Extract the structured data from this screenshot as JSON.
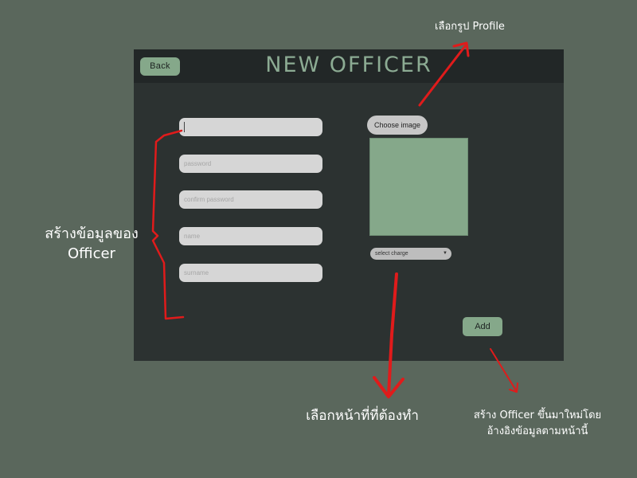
{
  "window": {
    "back_label": "Back",
    "title": "NEW OFFICER"
  },
  "form": {
    "fields": [
      {
        "placeholder": ""
      },
      {
        "placeholder": "password"
      },
      {
        "placeholder": "confirm password"
      },
      {
        "placeholder": "name"
      },
      {
        "placeholder": "surname"
      }
    ],
    "choose_image_label": "Choose image",
    "charge_select_value": "select charge",
    "add_label": "Add"
  },
  "annotations": {
    "profile_note": "เลือกรูป Profile",
    "officer_data_line1": "สร้างข้อมูลของ",
    "officer_data_line2": "Officer",
    "charge_note": "เลือกหน้าที่ที่ต้องทำ",
    "create_note_line1": "สร้าง Officer ขึ้นมาใหม่โดย",
    "create_note_line2": "อ้างอิงข้อมูลตามหน้านี้"
  },
  "colors": {
    "background": "#5a675c",
    "panel": "#2c3231",
    "accent": "#85a88a",
    "annotation_red": "#e01b1b"
  }
}
